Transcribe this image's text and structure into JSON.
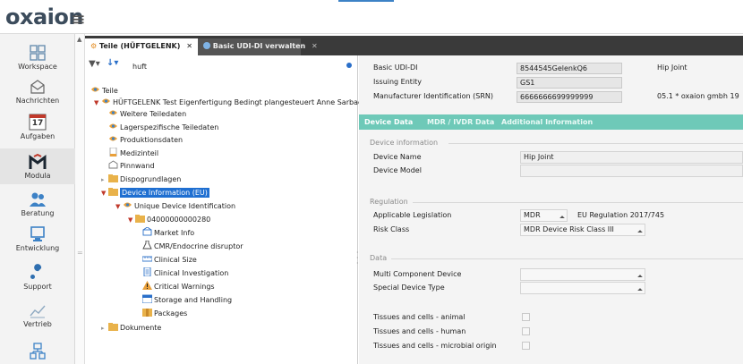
{
  "app": {
    "logo": "oxaion",
    "menu_icon": "hamburger-icon"
  },
  "nav": [
    {
      "label": "Workspace",
      "icon": "grid-icon"
    },
    {
      "label": "Nachrichten",
      "icon": "envelope-icon"
    },
    {
      "label": "Aufgaben",
      "icon": "calendar-icon",
      "badge": "17"
    },
    {
      "label": "Modula",
      "icon": "m-logo-icon"
    },
    {
      "label": "Beratung",
      "icon": "users-icon"
    },
    {
      "label": "Entwicklung",
      "icon": "monitor-icon"
    },
    {
      "label": "Support",
      "icon": "wrench-icon"
    },
    {
      "label": "Vertrieb",
      "icon": "chart-icon"
    }
  ],
  "tabs": [
    {
      "label": "Teile (HÜFTGELENK)",
      "close": "✕"
    },
    {
      "label": "Basic UDI-DI verwalten",
      "close": "✕"
    }
  ],
  "tree": {
    "filter_value": "huft",
    "nodes": [
      {
        "label": "Teile"
      },
      {
        "label": "HÜFTGELENK Test Eigenfertigung Bedingt plangesteuert Anne Sarbach"
      },
      {
        "label": "Weitere Teiledaten"
      },
      {
        "label": "Lagerspezifische Teiledaten"
      },
      {
        "label": "Produktionsdaten"
      },
      {
        "label": "Medizinteil"
      },
      {
        "label": "Pinnwand"
      },
      {
        "label": "Dispogrundlagen"
      },
      {
        "label": "Device Information (EU)"
      },
      {
        "label": "Unique Device Identification"
      },
      {
        "label": "04000000000280"
      },
      {
        "label": "Market Info"
      },
      {
        "label": "CMR/Endocrine disruptor"
      },
      {
        "label": "Clinical Size"
      },
      {
        "label": "Clinical Investigation"
      },
      {
        "label": "Critical Warnings"
      },
      {
        "label": "Storage and Handling"
      },
      {
        "label": "Packages"
      },
      {
        "label": "Dokumente"
      }
    ]
  },
  "header": {
    "basic_udi_label": "Basic UDI-DI",
    "basic_udi_value": "8544545GelenkQ6",
    "basic_udi_extra": "Hip Joint",
    "issuing_label": "Issuing Entity",
    "issuing_value": "GS1",
    "srn_label": "Manufacturer Identification (SRN)",
    "srn_value": "6666666699999999",
    "srn_extra": "05.1 * oxaion gmbh  19"
  },
  "subtabs": [
    "Device Data",
    "MDR / IVDR Data",
    "Additional Information"
  ],
  "sections": {
    "device_information": "Device information",
    "regulation": "Regulation",
    "data": "Data"
  },
  "fields": {
    "device_name_label": "Device Name",
    "device_name_value": "Hip Joint",
    "device_model_label": "Device Model",
    "device_model_value": "",
    "legislation_label": "Applicable Legislation",
    "legislation_value": "MDR",
    "legislation_extra": "EU Regulation 2017/745",
    "risk_label": "Risk Class",
    "risk_value": "MDR Device Risk Class III",
    "multi_label": "Multi Component Device",
    "multi_value": "",
    "special_label": "Special Device Type",
    "special_value": "",
    "tissue_animal_label": "Tissues and cells - animal",
    "tissue_human_label": "Tissues and cells - human",
    "tissue_microbial_label": "Tissues and cells - microbial origin"
  }
}
